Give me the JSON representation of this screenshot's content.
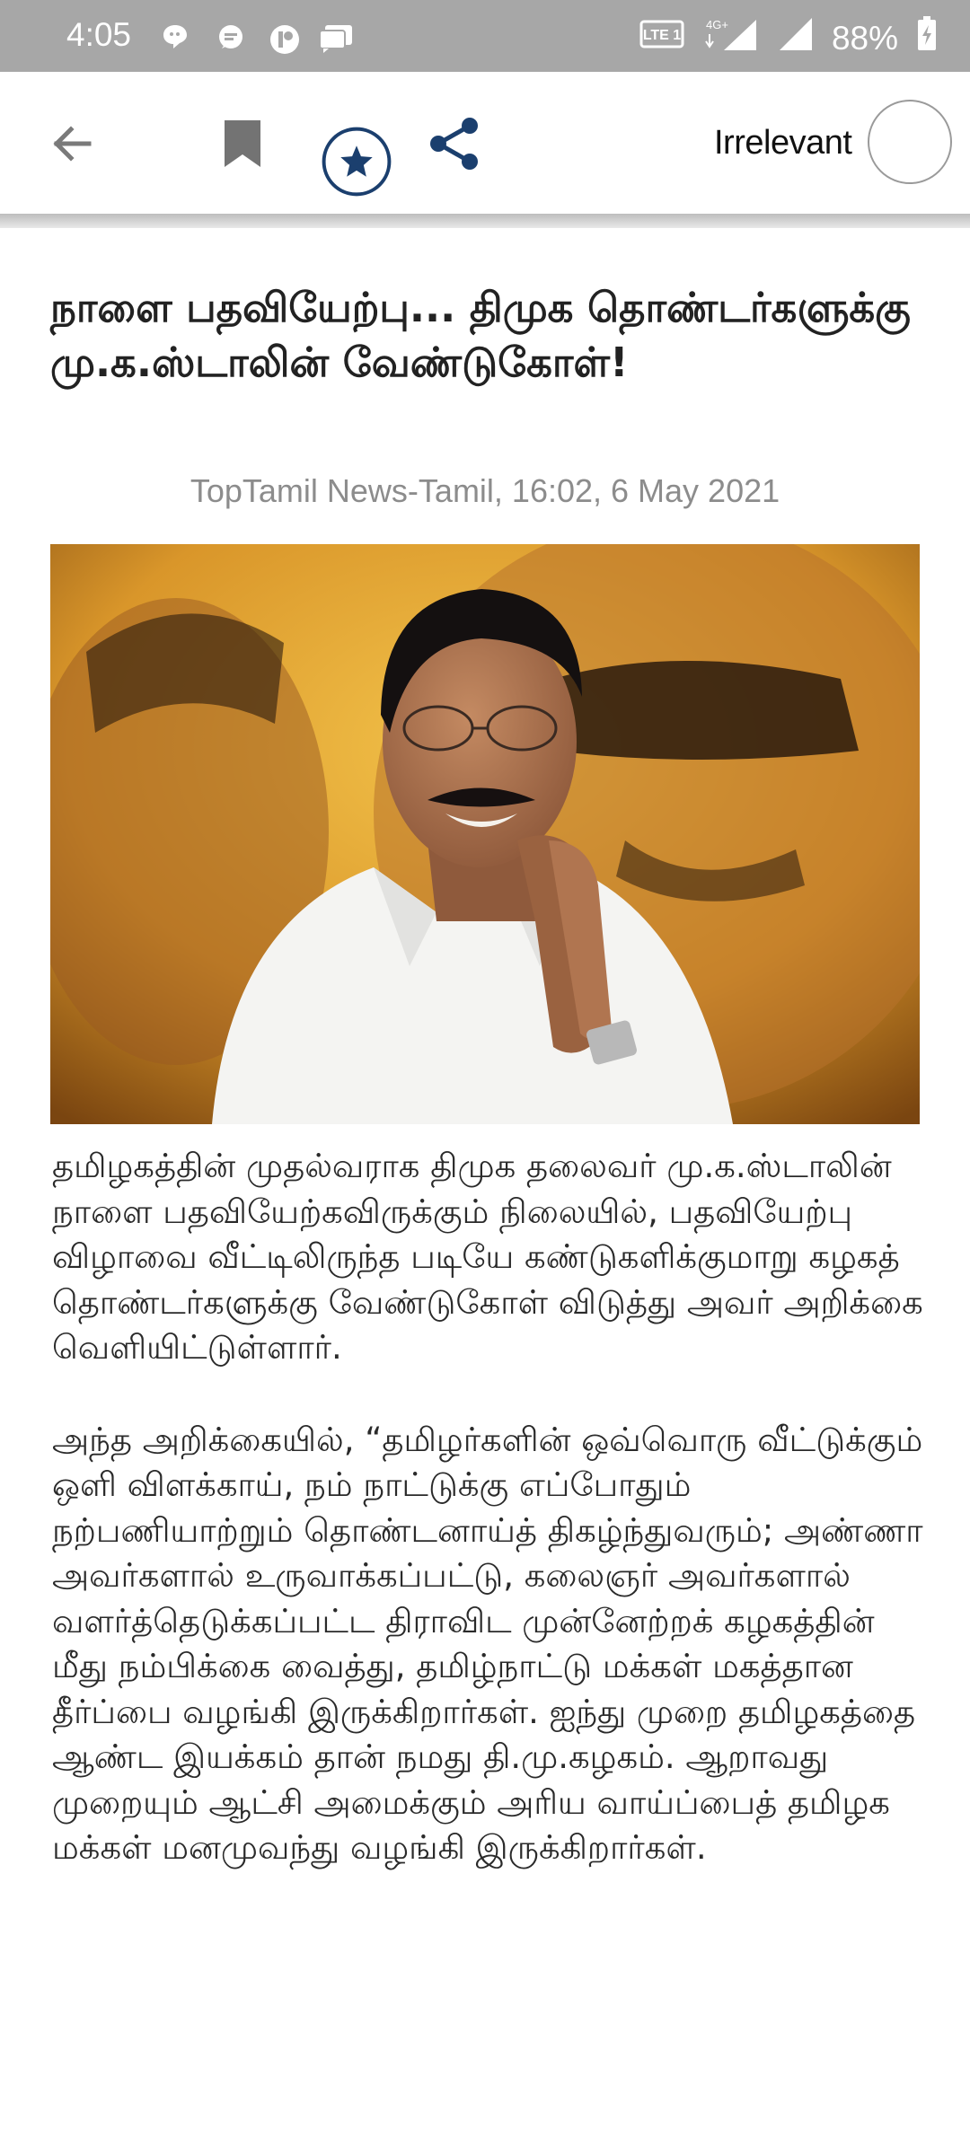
{
  "status_bar": {
    "time": "4:05",
    "battery": "88%",
    "network": "4G+",
    "lte_badge": "LTE 1",
    "notification_icons": [
      "chat-bubble-icon",
      "message-icon",
      "app-notification-icon",
      "messages-icon"
    ]
  },
  "toolbar": {
    "back_icon": "arrow-left-icon",
    "bookmark_icon": "bookmark-icon",
    "favorite_icon": "star-circle-icon",
    "share_icon": "share-icon",
    "irrelevant_label": "Irrelevant",
    "irrelevant_checked": false
  },
  "article": {
    "headline": "நாளை பதவியேற்பு... திமுக தொண்டர்களுக்கு மு.க.ஸ்டாலின் வேண்டுகோள்!",
    "meta": "TopTamil News-Tamil, 16:02, 6 May 2021",
    "paragraphs": [
      "தமிழகத்தின் முதல்வராக திமுக தலைவர் மு.க.ஸ்டாலின் நாளை பதவியேற்கவிருக்கும் நிலையில், பதவியேற்பு விழாவை வீட்டிலிருந்த படியே கண்டுகளிக்குமாறு கழகத் தொண்டர்களுக்கு வேண்டுகோள் விடுத்து அவர் அறிக்கை வெளியிட்டுள்ளார்.",
      "அந்த அறிக்கையில், “தமிழர்களின் ஒவ்வொரு வீட்டுக்கும் ஒளி விளக்காய், நம் நாட்டுக்கு எப்போதும் நற்பணியாற்றும் தொண்டனாய்த் திகழ்ந்துவரும்; அண்ணா அவர்களால் உருவாக்கப்பட்டு, கலைஞர் அவர்களால் வளர்த்தெடுக்கப்பட்ட திராவிட முன்னேற்றக் கழகத்தின் மீது நம்பிக்கை வைத்து, தமிழ்நாட்டு மக்கள் மகத்தான தீர்ப்பை வழங்கி இருக்கிறார்கள். ஐந்து முறை தமிழகத்தை ஆண்ட இயக்கம் தான் நமது தி.மு.கழகம். ஆறாவது முறையும் ஆட்சி அமைக்கும் அரிய வாய்ப்பைத் தமிழக மக்கள் மனமுவந்து வழங்கி இருக்கிறார்கள்."
    ]
  },
  "colors": {
    "status_bar": "#a7a7a7",
    "icon_blue": "#1b3f6e",
    "icon_gray": "#737373",
    "meta_gray": "#8c8c8c"
  }
}
